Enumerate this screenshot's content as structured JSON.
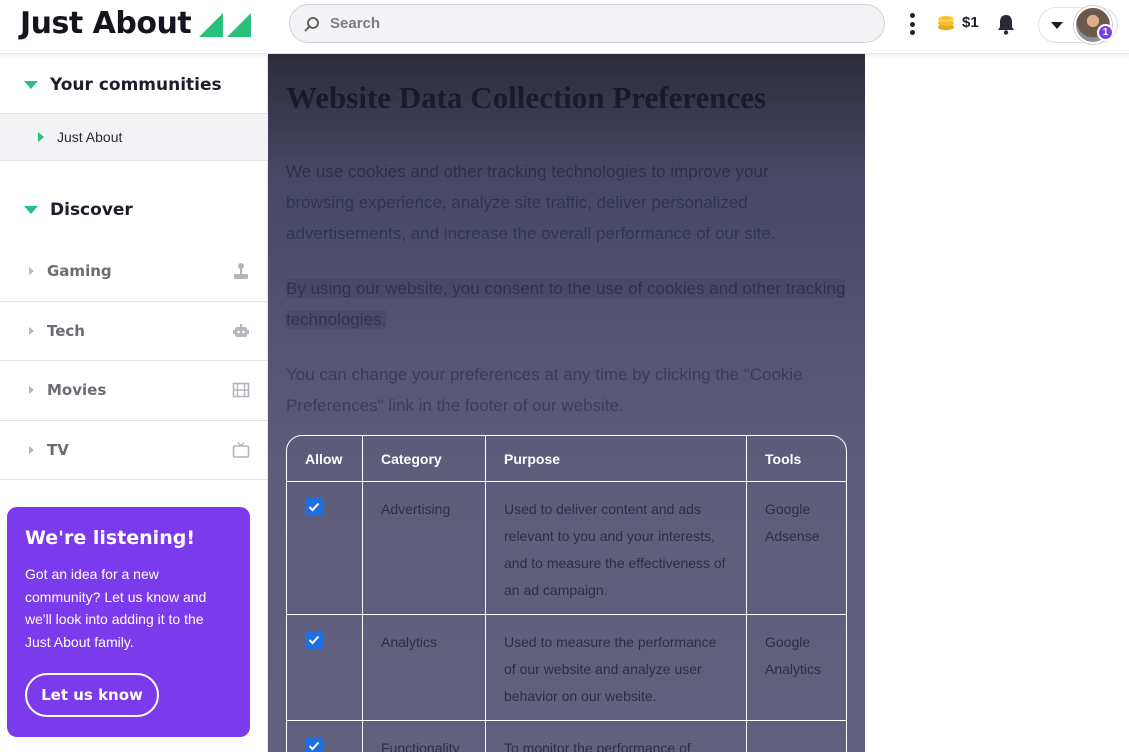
{
  "header": {
    "logo_text": "Just About",
    "search_placeholder": "Search",
    "coins_amount": "$1",
    "notification_count": "1"
  },
  "sidebar": {
    "communities_heading": "Your communities",
    "communities": [
      {
        "label": "Just About"
      }
    ],
    "discover_heading": "Discover",
    "discover_items": [
      {
        "label": "Gaming",
        "icon": "joystick-icon"
      },
      {
        "label": "Tech",
        "icon": "robot-icon"
      },
      {
        "label": "Movies",
        "icon": "film-icon"
      },
      {
        "label": "TV",
        "icon": "tv-icon"
      }
    ],
    "promo": {
      "title": "We're listening!",
      "body": "Got an idea for a new community? Let us know and we'll look into adding it to the Just About family.",
      "button_label": "Let us know"
    }
  },
  "main": {
    "title": "Website Data Collection Preferences",
    "para1_line1": "We use cookies and other tracking technologies to improve your",
    "para1_line2": "browsing experience, analyze site traffic, deliver personalized",
    "para1_line3": "advertisements, and increase the overall performance of our site.",
    "para2": "By using our website, you consent to the use of cookies and other tracking technologies.",
    "para3": "You can change your preferences at any time by clicking the \"Cookie Preferences\" link in the footer of our website.",
    "table": {
      "headers": [
        "Allow",
        "Category",
        "Purpose",
        "Tools"
      ],
      "rows": [
        {
          "allowed": true,
          "category": "Advertising",
          "purpose": "Used to deliver content and ads relevant to you and your interests, and to measure the effectiveness of an ad campaign.",
          "tools": "Google Adsense"
        },
        {
          "allowed": true,
          "category": "Analytics",
          "purpose": "Used to measure the performance of our website and analyze user behavior on our website.",
          "tools": "Google Analytics"
        },
        {
          "allowed": true,
          "category": "Functionality",
          "purpose": "To monitor the performance of",
          "tools": ""
        }
      ]
    }
  },
  "colors": {
    "brand_green": "#2bbf7c",
    "promo_purple": "#7c3aed",
    "checkbox_blue": "#1f6fe0",
    "badge_purple": "#7b3fe4"
  }
}
